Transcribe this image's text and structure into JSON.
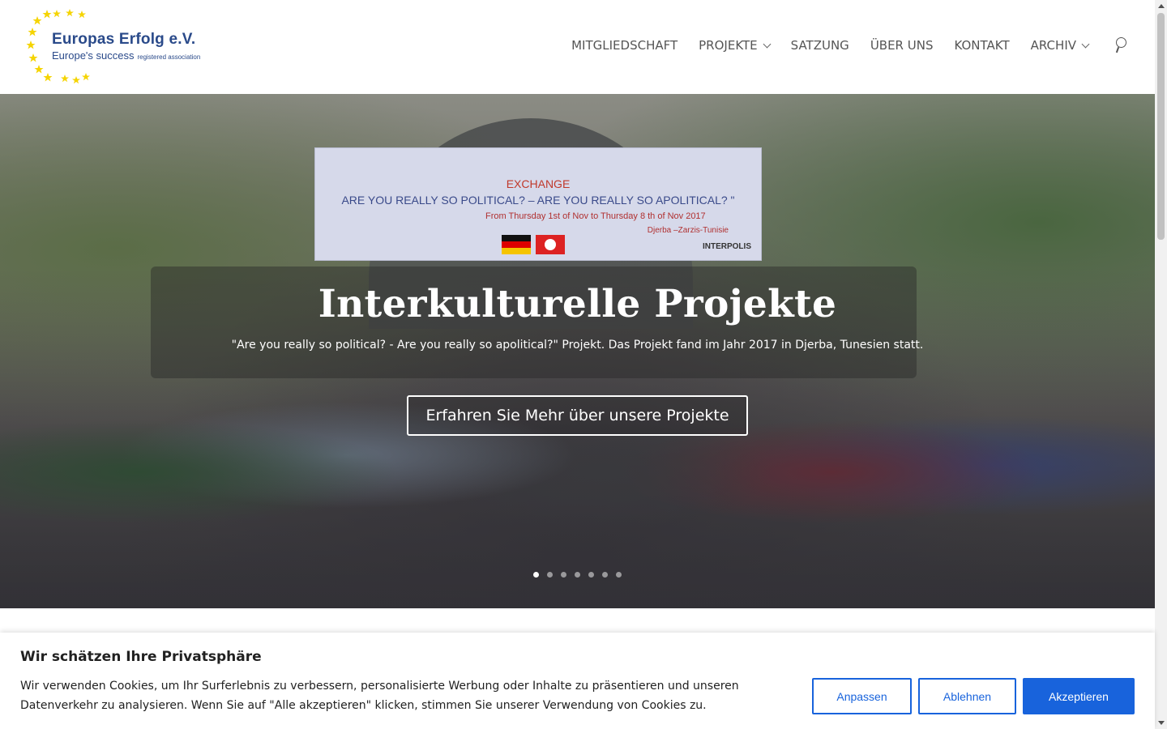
{
  "logo": {
    "title": "Europas Erfolg e.V.",
    "subtitle": "Europe's success",
    "subtitle_small": "registered association",
    "star_color": "#f5d400"
  },
  "nav": {
    "items": [
      {
        "label": "MITGLIEDSCHAFT",
        "has_dropdown": false
      },
      {
        "label": "PROJEKTE",
        "has_dropdown": true
      },
      {
        "label": "SATZUNG",
        "has_dropdown": false
      },
      {
        "label": "ÜBER UNS",
        "has_dropdown": false
      },
      {
        "label": "KONTAKT",
        "has_dropdown": false
      },
      {
        "label": "ARCHIV",
        "has_dropdown": true
      }
    ],
    "search_icon": "search-icon"
  },
  "hero": {
    "banner": {
      "exchange": "EXCHANGE",
      "line1": "ARE YOU REALLY SO POLITICAL? – ARE YOU REALLY SO APOLITICAL? \"",
      "line2": "From Thursday 1st of Nov to Thursday  8 th of Nov 2017",
      "line3": "Djerba –Zarzis-Tunisie",
      "interpolis": "INTERPOLIS"
    },
    "title": "Interkulturelle Projekte",
    "subtitle": "\"Are you really so political? - Are you really so apolitical?\" Projekt. Das Projekt fand im Jahr 2017 in Djerba, Tunesien statt.",
    "button_label": "Erfahren Sie Mehr über unsere Projekte",
    "slides_total": 7,
    "active_slide": 1
  },
  "cookie": {
    "title": "Wir schätzen Ihre Privatsphäre",
    "text": "Wir verwenden Cookies, um Ihr Surferlebnis zu verbessern, personalisierte Werbung oder Inhalte zu präsentieren und unseren Datenverkehr zu analysieren. Wenn Sie auf \"Alle akzeptieren\" klicken, stimmen Sie unserer Verwendung von Cookies zu.",
    "customize_label": "Anpassen",
    "reject_label": "Ablehnen",
    "accept_label": "Akzeptieren",
    "accent_color": "#1863dc"
  }
}
